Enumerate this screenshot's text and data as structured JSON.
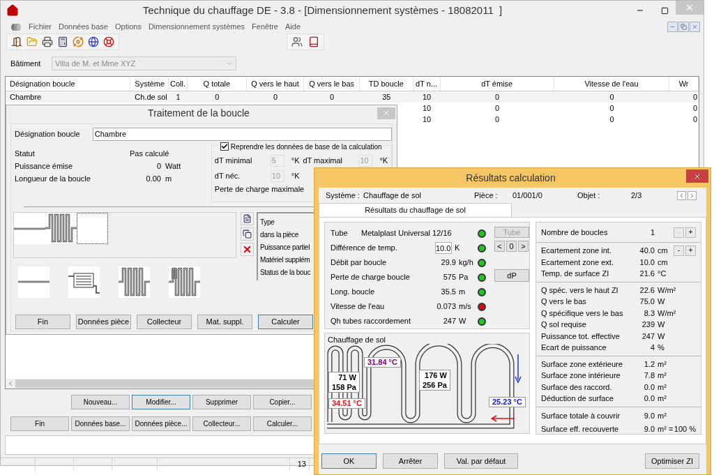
{
  "window": {
    "title": "Technique du chauffage DE - 3.8 - [Dimensionnement systèmes - 18082011  ]"
  },
  "menu": [
    "Fichier",
    "Données base",
    "Options",
    "Dimensionnement systèmes",
    "Fenêtre",
    "Aide"
  ],
  "building": {
    "label": "Bâtiment",
    "value": "Villa de M. et Mme XYZ",
    "disabled": true
  },
  "table": {
    "columns": [
      "Désignation boucle",
      "Système",
      "Coll.",
      "Q totale",
      "Q vers le haut",
      "Q vers le bas",
      "TD boucle",
      "dT n...",
      "dT émise",
      "Vitesse de l'eau",
      "Wr"
    ],
    "rows": [
      {
        "cells": [
          "Chambre",
          "Ch.de sol",
          "1",
          "0",
          "0",
          "0",
          "35",
          "10",
          "0",
          "0",
          "0"
        ]
      },
      {
        "cells": [
          null,
          null,
          null,
          null,
          null,
          null,
          null,
          "10",
          "0",
          "0",
          "0"
        ]
      },
      {
        "cells": [
          null,
          null,
          null,
          null,
          null,
          null,
          null,
          "10",
          "0",
          "0",
          "0"
        ]
      }
    ]
  },
  "main_buttons": [
    [
      {
        "label": "Nouveau...",
        "focused": false
      },
      {
        "label": "Modifier...",
        "focused": true
      },
      {
        "label": "Supprimer",
        "focused": false
      },
      {
        "label": "Copier...",
        "focused": false
      }
    ],
    [
      {
        "label": "Fin",
        "focused": false
      },
      {
        "label": "Données base...",
        "focused": false
      },
      {
        "label": "Données pièce...",
        "focused": false
      },
      {
        "label": "Collecteur...",
        "focused": false
      },
      {
        "label": "Calculer...",
        "focused": false
      }
    ]
  ],
  "status_bar": {
    "count": "13"
  },
  "loop_dialog": {
    "title": "Traitement de la boucle",
    "name_field": {
      "label": "Désignation boucle",
      "value": "Chambre"
    },
    "info": [
      {
        "label": "Statut",
        "value": "Pas calculé"
      },
      {
        "label": "Puissance émise",
        "value": "0",
        "unit": "Watt"
      },
      {
        "label": "Longueur de la boucle",
        "value": "0.00",
        "unit": "m"
      }
    ],
    "base_data": {
      "checkbox": {
        "label": "Reprendre les données de base de la calculation",
        "checked": true
      },
      "fields": [
        {
          "label": "dT minimal",
          "value": "5",
          "unit": "°K",
          "disabled": true
        },
        {
          "label": "dT maximal",
          "value": "10",
          "unit": "°K",
          "disabled": true
        },
        {
          "label": "dT néc.",
          "value": "10",
          "unit": "°K",
          "disabled": true
        }
      ],
      "note": "Perte de charge maximale"
    },
    "segments": [
      {
        "kind": "straight",
        "selected": false
      },
      {
        "kind": "meander",
        "selected": false
      },
      {
        "kind": "empty",
        "selected": true
      }
    ],
    "properties": [
      "Type",
      "dans la pièce",
      "Puissance partiel",
      "Matériel supplém",
      "Status de la bouc"
    ],
    "tiles": [
      {
        "kind": "straight"
      },
      {
        "kind": "radiator"
      },
      {
        "kind": "meander"
      },
      {
        "kind": "meander-radiator"
      }
    ],
    "buttons": [
      {
        "label": "Fin",
        "focused": false
      },
      {
        "label": "Données pièce",
        "focused": false
      },
      {
        "label": "Collecteur",
        "focused": false
      },
      {
        "label": "Mat. suppl.",
        "focused": false
      },
      {
        "label": "Calculer",
        "focused": true
      }
    ]
  },
  "results_dialog": {
    "title": "Résultats calculation",
    "system": {
      "label": "Système :",
      "value": "Chauffage de sol"
    },
    "room": {
      "label": "Pièce :",
      "value": "01/001/0"
    },
    "object": {
      "label": "Objet :",
      "value": "2/3"
    },
    "tabs": [
      {
        "label": "Résultats du chauffage de sol",
        "selected": true
      }
    ],
    "checks": [
      {
        "kind": "name",
        "label": "Tube",
        "value": "Metalplast Universal 12/16",
        "color": "#22c322"
      },
      {
        "kind": "input",
        "label": "Différence de temp.",
        "value": "10.0",
        "unit": "K",
        "color": "#22c322"
      },
      {
        "kind": "reading",
        "label": "Débit par boucle",
        "value": "29.9",
        "unit": "kg/h",
        "color": "#22c322"
      },
      {
        "kind": "reading",
        "label": "Perte de charge boucle",
        "value": "575",
        "unit": "Pa",
        "color": "#22c322"
      },
      {
        "kind": "reading",
        "label": "Long. boucle",
        "value": "35.5",
        "unit": "m",
        "color": "#22c322"
      },
      {
        "kind": "reading",
        "label": "Vitesse de l'eau",
        "value": "0.073",
        "unit": "m/s",
        "color": "#d01010"
      },
      {
        "kind": "reading",
        "label": "Qh tubes raccordement",
        "value": "247",
        "unit": "W",
        "color": "#22c322"
      }
    ],
    "tube_button": {
      "label": "Tube",
      "disabled": true
    },
    "stepper": [
      "<",
      "0",
      ">"
    ],
    "dp_button": "dP",
    "loop_chart": {
      "title": "Chauffage de sol",
      "labels": [
        {
          "kind": "temp",
          "text": "31.84 °C",
          "color": "#800080"
        },
        {
          "kind": "load",
          "lines": [
            "71 W",
            "158 Pa"
          ]
        },
        {
          "kind": "load",
          "lines": [
            "176 W",
            "256 Pa"
          ]
        },
        {
          "kind": "temp",
          "text": "34.51 °C",
          "color": "#ee1111"
        },
        {
          "kind": "temp",
          "text": "25.23 °C",
          "color": "#1111ee"
        }
      ]
    },
    "figures": [
      [
        {
          "label": "Nombre de boucles",
          "value": "1",
          "stepper": [
            {
              "label": "-",
              "disabled": true
            },
            {
              "label": "+",
              "disabled": false
            }
          ]
        }
      ],
      [
        {
          "label": "Ecartement zone int.",
          "value": "40.0",
          "unit": "cm",
          "stepper": [
            {
              "label": "-",
              "disabled": false
            },
            {
              "label": "+",
              "disabled": false
            }
          ]
        },
        {
          "label": "Ecartement zone ext.",
          "value": "10.0",
          "unit": "cm"
        },
        {
          "label": "Temp. de surface ZI",
          "value": "21.6",
          "unit": "°C"
        }
      ],
      [
        {
          "label": "Q spéc. vers le haut ZI",
          "value": "22.6",
          "unit": "W/m²"
        },
        {
          "label": "Q vers le bas",
          "value": "75.0",
          "unit": "W"
        },
        {
          "label": "Q spécifique vers le bas",
          "value": "8.3",
          "unit": "W/m²"
        },
        {
          "label": "Q sol requise",
          "value": "239",
          "unit": "W"
        },
        {
          "label": "Puissance tot. effective",
          "value": "247",
          "unit": "W"
        },
        {
          "label": "Ecart de puissance",
          "value": "4",
          "unit": "%"
        }
      ],
      [
        {
          "label": "Surface zone extérieure",
          "value": "1.2",
          "unit": "m²"
        },
        {
          "label": "Surface zone intérieure",
          "value": "7.8",
          "unit": "m²"
        },
        {
          "label": "Surface des raccord.",
          "value": "0.0",
          "unit": "m²"
        },
        {
          "label": "Déduction de surface",
          "value": "0.0",
          "unit": "m²"
        }
      ],
      [
        {
          "label": "Surface totale à couvrir",
          "value": "9.0",
          "unit": "m²"
        },
        {
          "label": "Surface eff. recouverte",
          "value": "9.0",
          "unit": "m² =",
          "extra": "100 %"
        }
      ]
    ],
    "buttons": [
      {
        "label": "OK",
        "focused": true
      },
      {
        "label": "Arrêter",
        "focused": false
      },
      {
        "label": "Val. par défaut",
        "focused": false
      }
    ],
    "optimize_button": "Optimiser ZI"
  }
}
